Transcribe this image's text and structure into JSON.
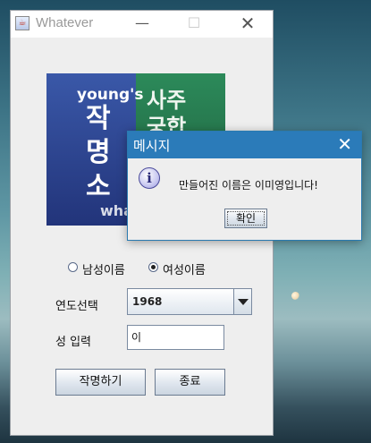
{
  "main_window": {
    "title": "Whatever",
    "controls": {
      "minimize": "—",
      "maximize": "☐",
      "close": "✕"
    },
    "image_text": {
      "sign_line1": "young's",
      "sign_big": [
        "작",
        "명",
        "소"
      ],
      "side_text": [
        "사주",
        "궁합"
      ],
      "bottom_text": "wha"
    },
    "gender": {
      "options": [
        {
          "label": "남성이름",
          "selected": false
        },
        {
          "label": "여성이름",
          "selected": true
        }
      ]
    },
    "year_label": "연도선택",
    "year_value": "1968",
    "surname_label": "성 입력",
    "surname_value": "이",
    "create_button": "작명하기",
    "exit_button": "종료"
  },
  "dialog": {
    "title": "메시지",
    "close": "✕",
    "icon": "info-icon",
    "icon_glyph": "i",
    "message": "만들어진 이름은 이미영입니다!",
    "ok_button": "확인"
  },
  "colors": {
    "dialog_titlebar": "#2b7bb9",
    "window_bg": "#eeeeee"
  }
}
